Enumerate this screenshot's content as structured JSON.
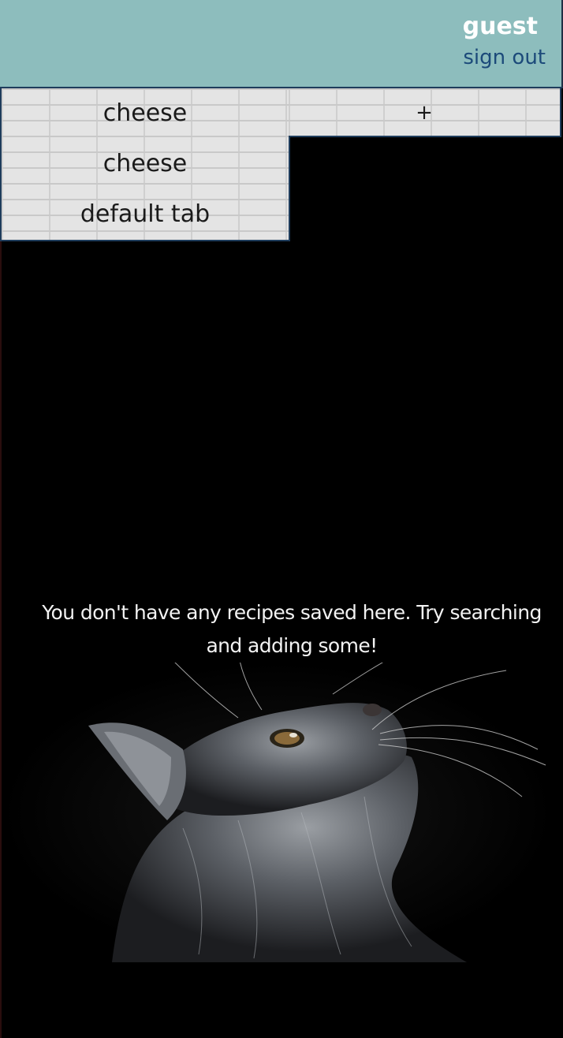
{
  "header": {
    "user_name": "guest",
    "sign_out_label": "sign out"
  },
  "tabs": [
    {
      "label": "cheese"
    },
    {
      "label": "cheese"
    },
    {
      "label": "default tab"
    }
  ],
  "add_tab_label": "+",
  "empty_state": {
    "message": "You don't have any recipes saved here. Try searching and adding some!"
  },
  "colors": {
    "header_bg": "#8dbdbd",
    "sign_out": "#1c4a7a",
    "border": "#1f3d5c",
    "page_bg": "#000000"
  }
}
